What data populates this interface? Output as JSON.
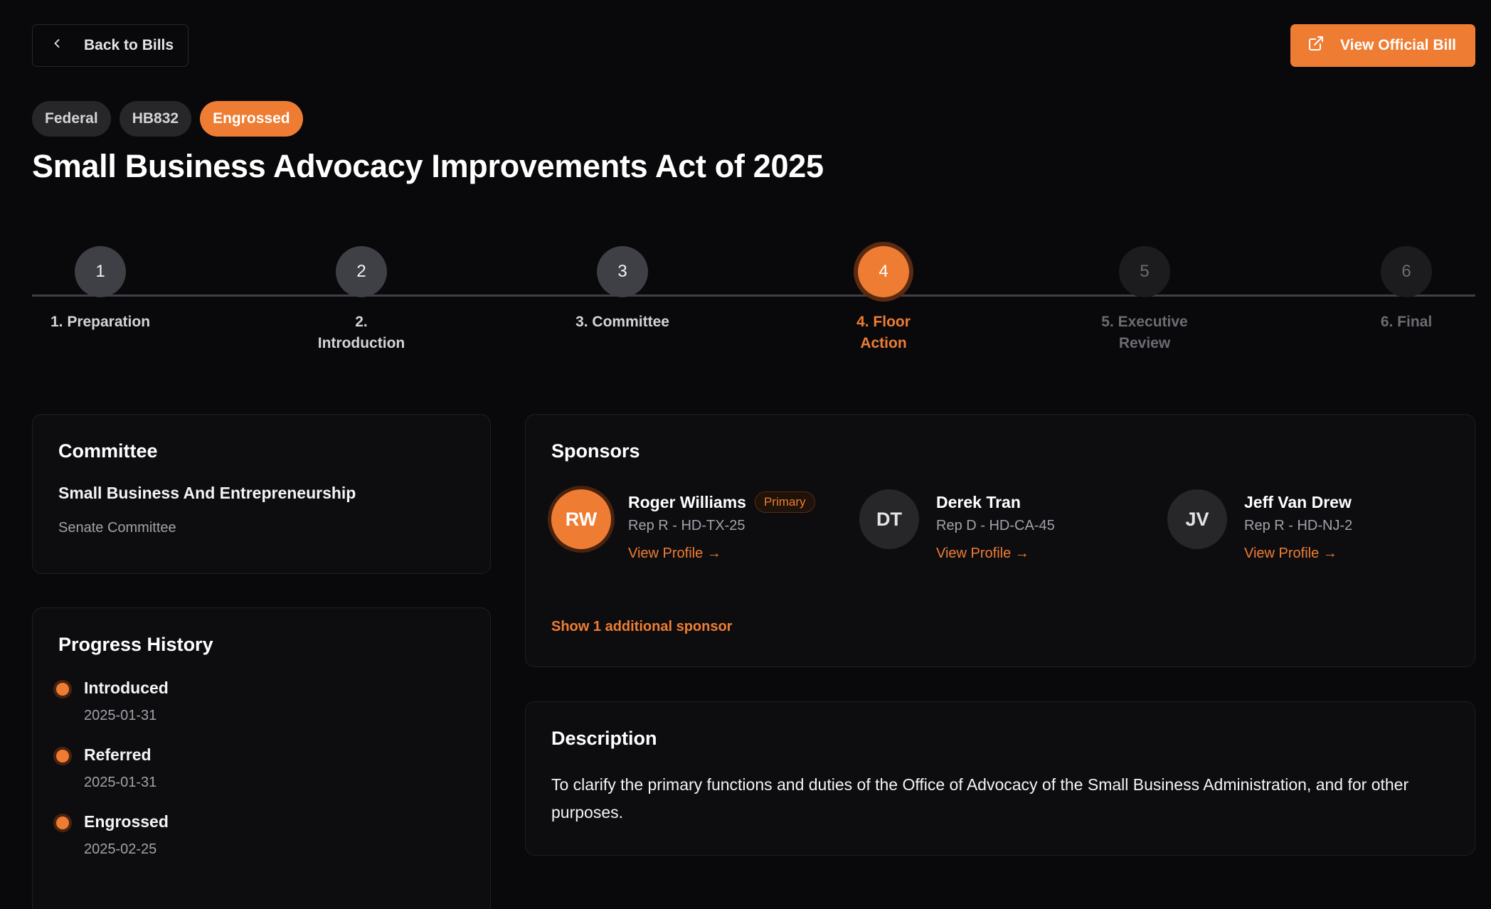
{
  "nav": {
    "back_label": "Back to Bills",
    "official_label": "View Official Bill"
  },
  "badges": {
    "level": "Federal",
    "number": "HB832",
    "status": "Engrossed"
  },
  "title": "Small Business Advocacy Improvements Act of 2025",
  "stepper": {
    "steps": [
      {
        "num": "1",
        "label_1": "1. Preparation",
        "label_2": "",
        "state": "done"
      },
      {
        "num": "2",
        "label_1": "2.",
        "label_2": "Introduction",
        "state": "done"
      },
      {
        "num": "3",
        "label_1": "3. Committee",
        "label_2": "",
        "state": "done"
      },
      {
        "num": "4",
        "label_1": "4. Floor",
        "label_2": "Action",
        "state": "current"
      },
      {
        "num": "5",
        "label_1": "5. Executive",
        "label_2": "Review",
        "state": "future"
      },
      {
        "num": "6",
        "label_1": "6. Final",
        "label_2": "",
        "state": "future"
      }
    ]
  },
  "committee": {
    "heading": "Committee",
    "name": "Small Business And Entrepreneurship",
    "chamber": "Senate Committee"
  },
  "history": {
    "heading": "Progress History",
    "items": [
      {
        "label": "Introduced",
        "date": "2025-01-31"
      },
      {
        "label": "Referred",
        "date": "2025-01-31"
      },
      {
        "label": "Engrossed",
        "date": "2025-02-25"
      }
    ]
  },
  "sponsors": {
    "heading": "Sponsors",
    "primary_badge": "Primary",
    "link_label": "View Profile →",
    "items": [
      {
        "initials": "RW",
        "name": "Roger Williams",
        "role": "Rep R - HD-TX-25"
      },
      {
        "initials": "DT",
        "name": "Derek Tran",
        "role": "Rep D - HD-CA-45"
      },
      {
        "initials": "JV",
        "name": "Jeff Van Drew",
        "role": "Rep R - HD-NJ-2"
      }
    ],
    "show_more": "Show 1 additional sponsor"
  },
  "description": {
    "heading": "Description",
    "text": "To clarify the primary functions and duties of the Office of Advocacy of the Small Business Administration, and for other purposes."
  },
  "colors": {
    "accent": "#ee7d33",
    "background": "#09090b",
    "card": "#0d0d10"
  },
  "icons": {
    "back": "chevron-left-icon",
    "official": "external-link-icon"
  }
}
